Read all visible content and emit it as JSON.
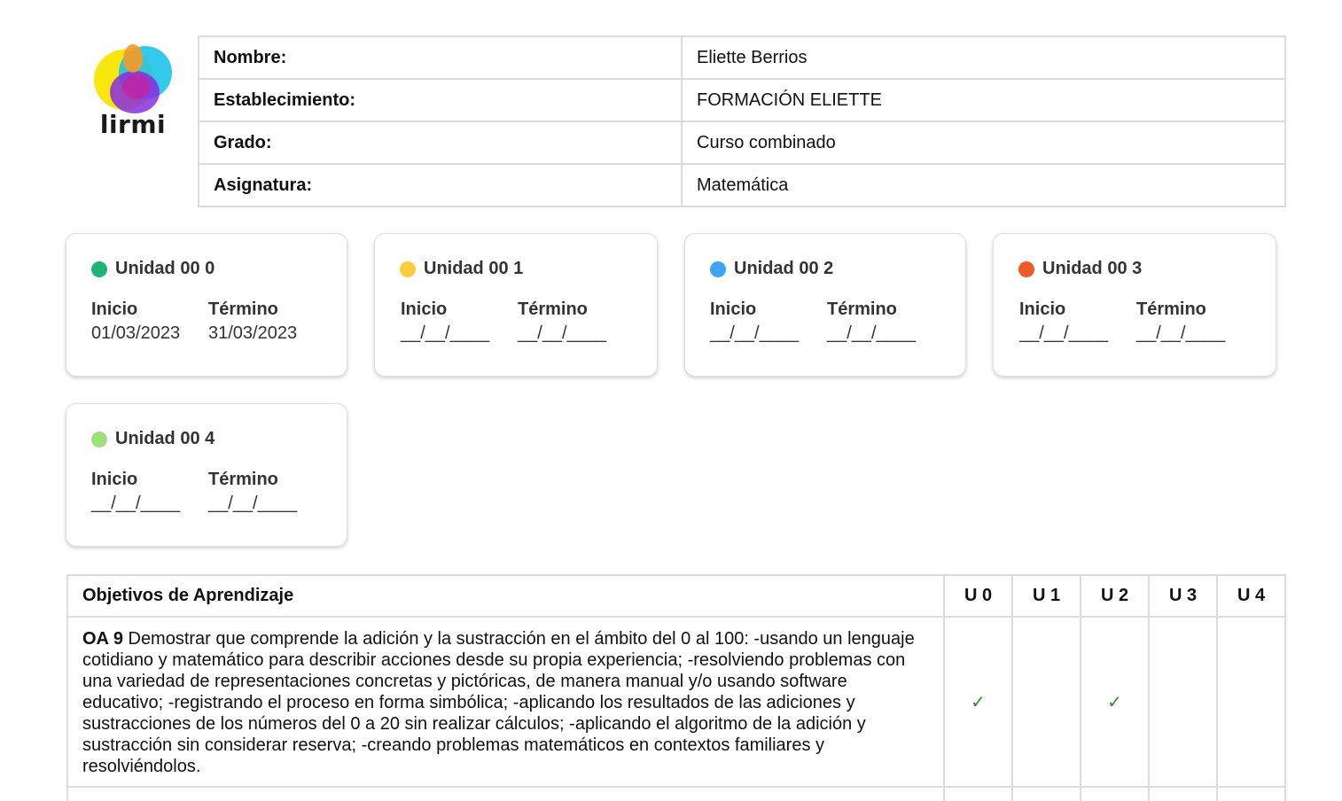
{
  "logo": {
    "brand": "lirmi"
  },
  "info": {
    "rows": [
      {
        "label": "Nombre:",
        "value": "Eliette Berrios"
      },
      {
        "label": "Establecimiento:",
        "value": "FORMACIÓN ELIETTE"
      },
      {
        "label": "Grado:",
        "value": "Curso combinado"
      },
      {
        "label": "Asignatura:",
        "value": "Matemática"
      }
    ]
  },
  "units": [
    {
      "title": "Unidad 00 0",
      "color": "#1fb573",
      "start_label": "Inicio",
      "end_label": "Término",
      "start": "01/03/2023",
      "end": "31/03/2023"
    },
    {
      "title": "Unidad 00 1",
      "color": "#fbcd3b",
      "start_label": "Inicio",
      "end_label": "Término",
      "start": "__/__/____",
      "end": "__/__/____"
    },
    {
      "title": "Unidad 00 2",
      "color": "#3aa4f5",
      "start_label": "Inicio",
      "end_label": "Término",
      "start": "__/__/____",
      "end": "__/__/____"
    },
    {
      "title": "Unidad 00 3",
      "color": "#f05a28",
      "start_label": "Inicio",
      "end_label": "Término",
      "start": "__/__/____",
      "end": "__/__/____"
    },
    {
      "title": "Unidad 00 4",
      "color": "#9ee07c",
      "start_label": "Inicio",
      "end_label": "Término",
      "start": "__/__/____",
      "end": "__/__/____"
    }
  ],
  "objectives": {
    "header": "Objetivos de Aprendizaje",
    "unit_headers": [
      "U 0",
      "U 1",
      "U 2",
      "U 3",
      "U 4"
    ],
    "check_symbol": "✓",
    "rows": [
      {
        "code": "OA 9",
        "text": " Demostrar que comprende la adición y la sustracción en el ámbito del 0 al 100: -usando un lenguaje cotidiano y matemático para describir acciones desde su propia experiencia; -resolviendo problemas con una variedad de representaciones concretas y pictóricas, de manera manual y/o usando software educativo; -registrando el proceso en forma simbólica; -aplicando los resultados de las adiciones y sustracciones de los números del 0 a 20 sin realizar cálculos; -aplicando el algoritmo de la adición y sustracción sin considerar reserva; -creando problemas matemáticos en contextos familiares y resolviéndolos.",
        "checks": [
          true,
          false,
          true,
          false,
          false
        ]
      }
    ]
  }
}
